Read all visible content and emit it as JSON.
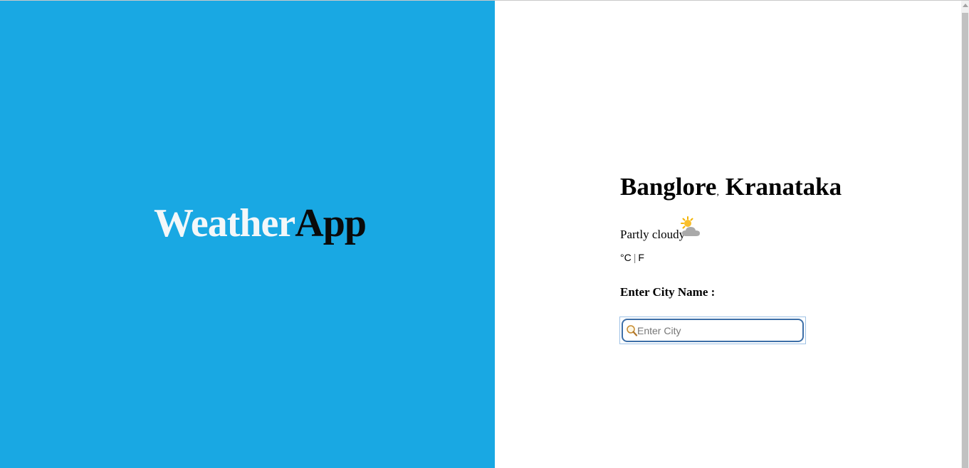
{
  "brand": {
    "part1": "Weather",
    "part2": "App"
  },
  "location": {
    "city": "Banglore",
    "separator": ",",
    "region": "Kranataka"
  },
  "weather": {
    "condition": "Partly cloudy",
    "icon": "partly-cloudy-icon"
  },
  "units": {
    "celsius": "°C",
    "divider": "|",
    "fahrenheit": "F"
  },
  "search": {
    "label": "Enter City Name :",
    "placeholder": "Enter City",
    "value": "",
    "icon": "search-icon"
  },
  "colors": {
    "left_panel_bg": "#19a8e3",
    "brand_light": "#f3f7f9",
    "brand_dark": "#0a0a0a",
    "input_border": "#3d6fa8"
  }
}
